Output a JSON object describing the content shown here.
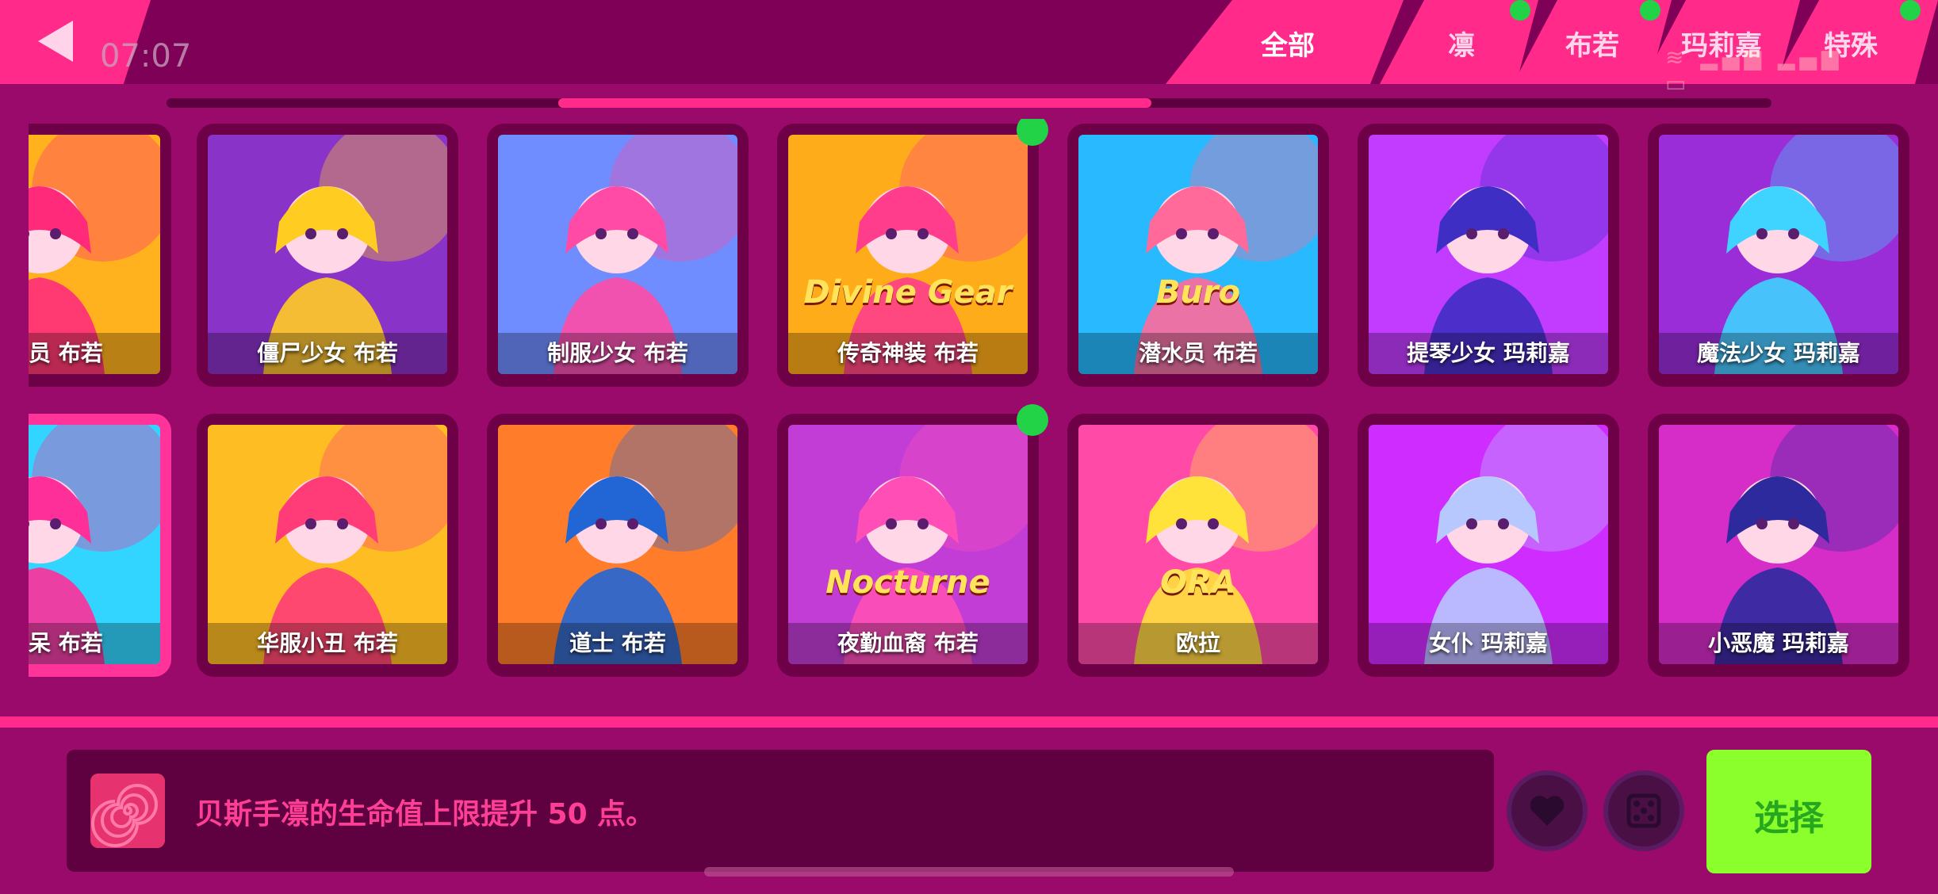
{
  "clock": "07:07",
  "tabs": [
    {
      "label": "全部",
      "active": true,
      "dot": false
    },
    {
      "label": "凛",
      "active": false,
      "dot": true
    },
    {
      "label": "布若",
      "active": false,
      "dot": true
    },
    {
      "label": "玛莉嘉",
      "active": false,
      "dot": false
    },
    {
      "label": "特殊",
      "active": false,
      "dot": true
    }
  ],
  "cards": [
    {
      "label": "员 布若",
      "art": "#ffb21e",
      "accent": "#ff2b7a",
      "row": 0,
      "col": 0
    },
    {
      "label": "僵尸少女 布若",
      "art": "#8a33c8",
      "accent": "#ffcc22",
      "row": 0,
      "col": 1
    },
    {
      "label": "制服少女 布若",
      "art": "#6f8dff",
      "accent": "#ff4aa6",
      "row": 0,
      "col": 2
    },
    {
      "label": "传奇神装 布若",
      "art": "#ffac1a",
      "accent": "#ff3d8c",
      "row": 0,
      "col": 3,
      "dot": true,
      "overlay": "Divine Gear"
    },
    {
      "label": "潜水员 布若",
      "art": "#28b9ff",
      "accent": "#ff6a9a",
      "row": 0,
      "col": 4,
      "overlay": "Buro"
    },
    {
      "label": "提琴少女 玛莉嘉",
      "art": "#c23cff",
      "accent": "#3f2ec4",
      "row": 0,
      "col": 5
    },
    {
      "label": "魔法少女 玛莉嘉",
      "art": "#9a2dd8",
      "accent": "#3fd3ff",
      "row": 0,
      "col": 6
    },
    {
      "label": "呆 布若",
      "art": "#32d5ff",
      "accent": "#ff2f9a",
      "row": 1,
      "col": 0,
      "selected": true
    },
    {
      "label": "华服小丑 布若",
      "art": "#ffbd24",
      "accent": "#ff3b78",
      "row": 1,
      "col": 1
    },
    {
      "label": "道士 布若",
      "art": "#ff7c2a",
      "accent": "#2266d6",
      "row": 1,
      "col": 2
    },
    {
      "label": "夜勤血裔 布若",
      "art": "#c23cd6",
      "accent": "#ff4fb6",
      "row": 1,
      "col": 3,
      "dot": true,
      "overlay": "Nocturne"
    },
    {
      "label": "欧拉",
      "art": "#ff4aa8",
      "accent": "#ffe23a",
      "row": 1,
      "col": 4,
      "overlay": "ORA"
    },
    {
      "label": "女仆 玛莉嘉",
      "art": "#cf2cff",
      "accent": "#b7c8ff",
      "row": 1,
      "col": 5
    },
    {
      "label": "小恶魔 玛莉嘉",
      "art": "#d62cc8",
      "accent": "#2d2a9e",
      "row": 1,
      "col": 6
    }
  ],
  "description": "贝斯手凛的生命值上限提升 50 点。",
  "select_label": "选择",
  "icons": {
    "back": "back-arrow-icon",
    "heart": "heart-icon",
    "dice": "dice-icon",
    "spiral": "spiral-icon"
  }
}
